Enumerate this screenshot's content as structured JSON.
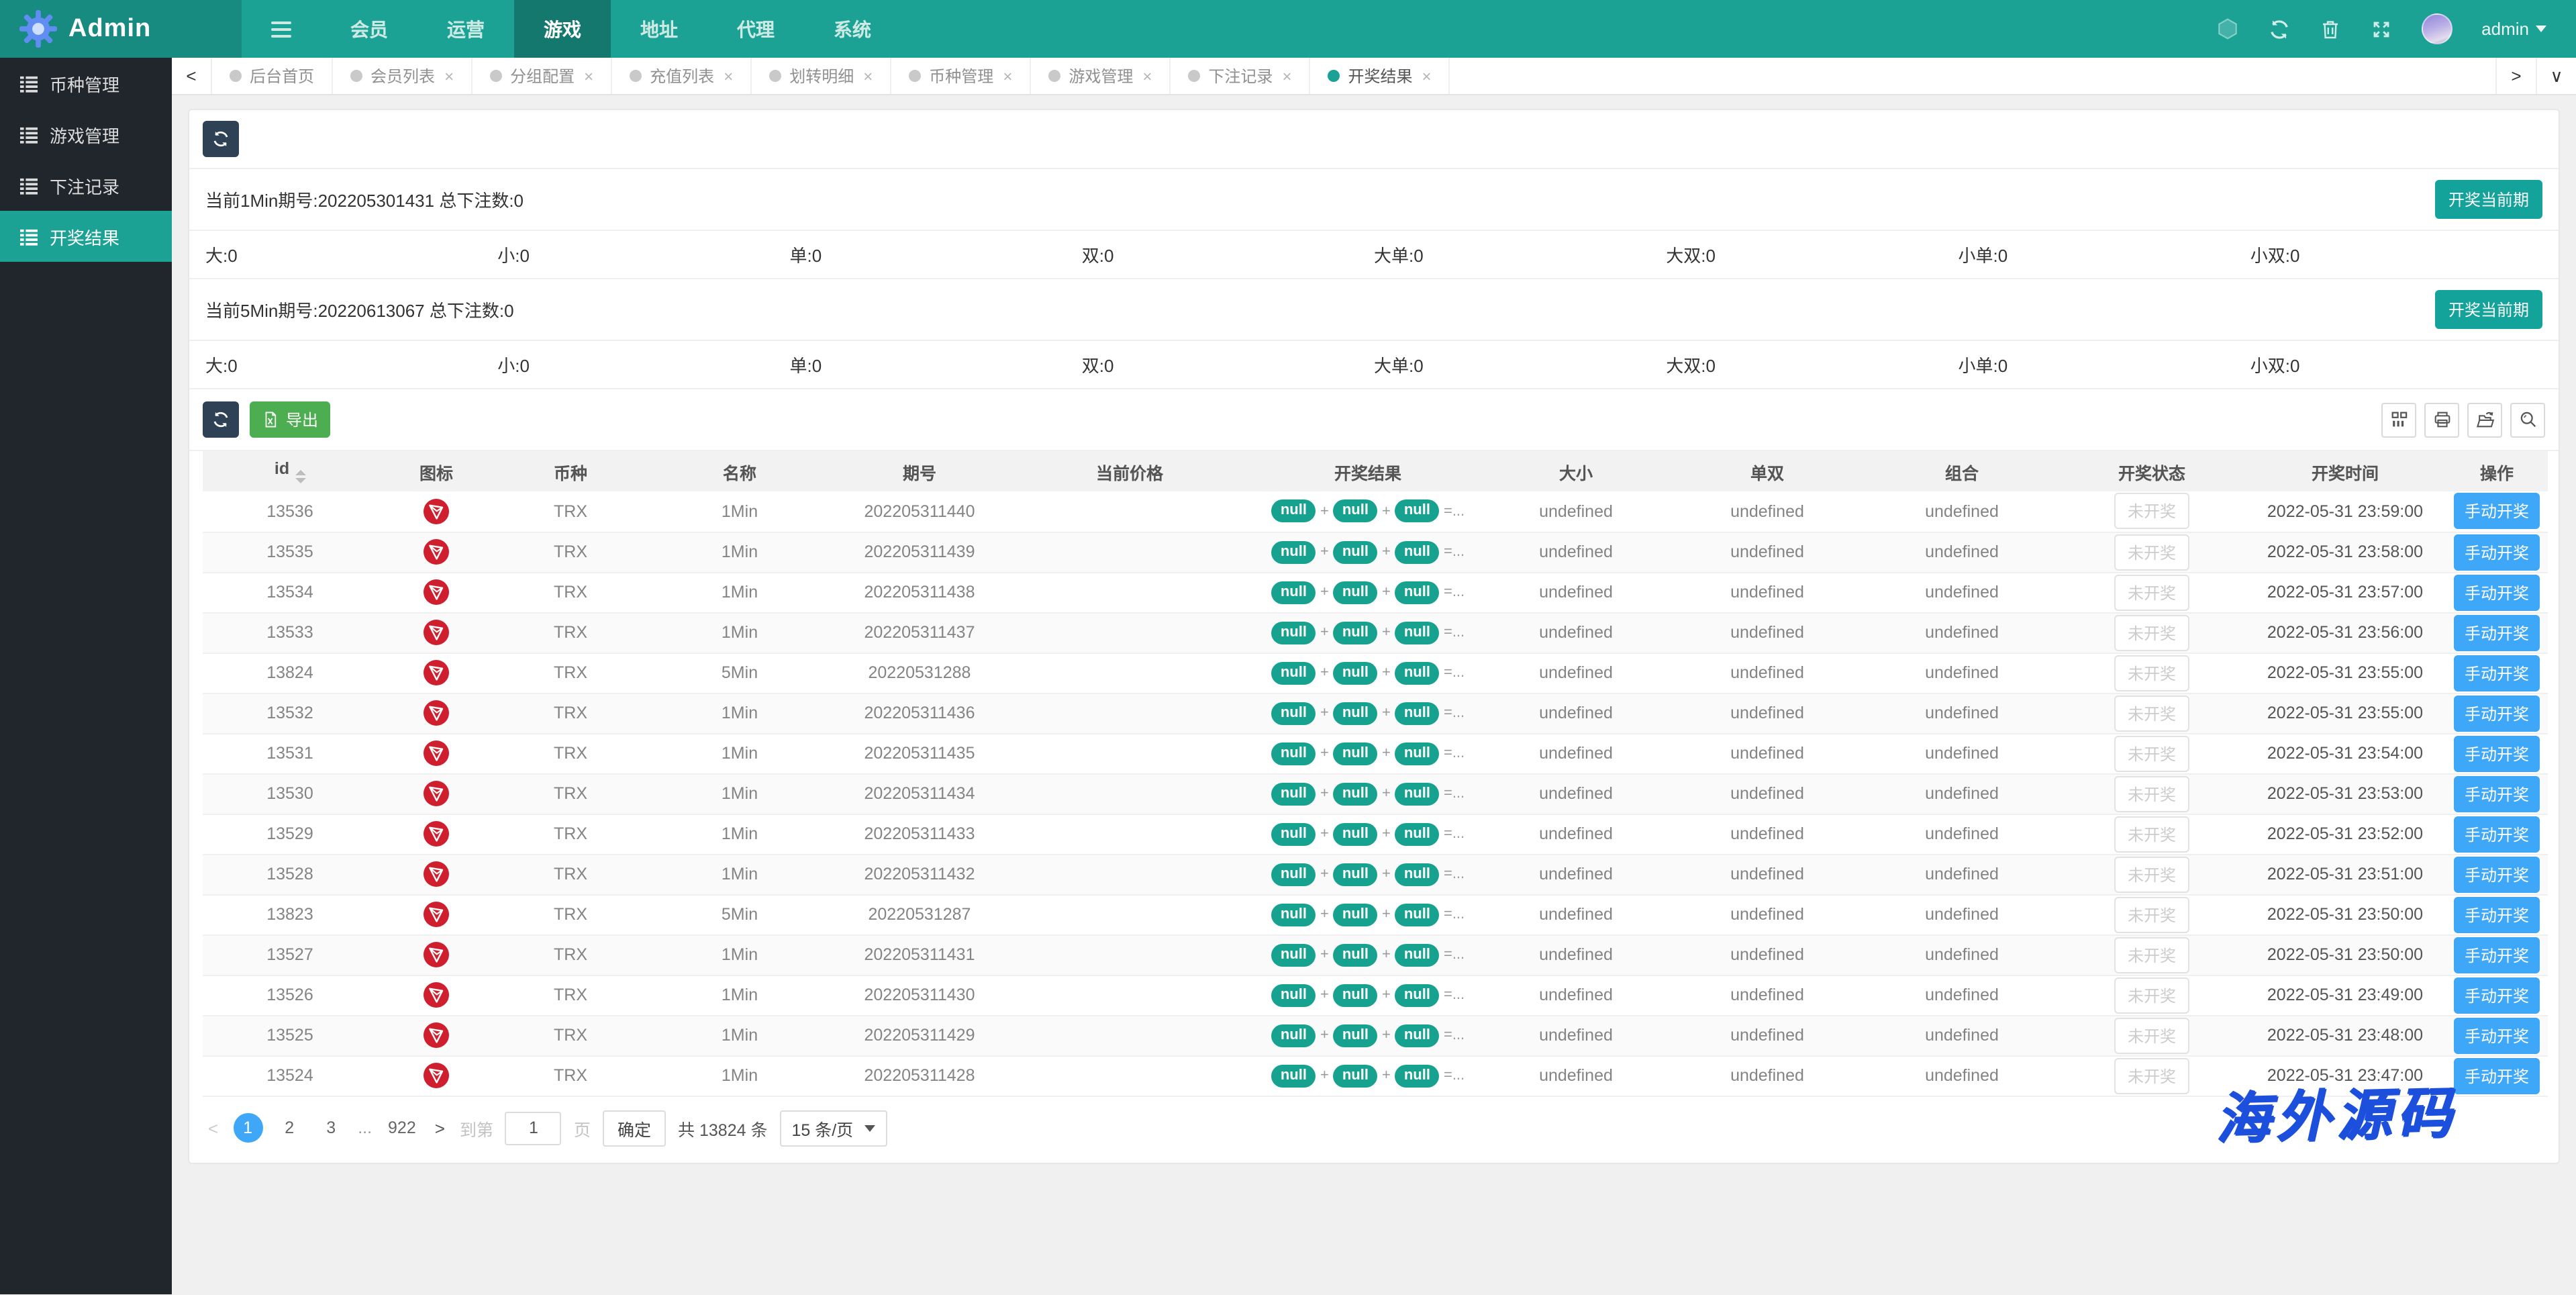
{
  "navbar": {
    "brand": "Admin",
    "menu": [
      {
        "label": "会员",
        "active": false
      },
      {
        "label": "运营",
        "active": false
      },
      {
        "label": "游戏",
        "active": true
      },
      {
        "label": "地址",
        "active": false
      },
      {
        "label": "代理",
        "active": false
      },
      {
        "label": "系统",
        "active": false
      }
    ],
    "username": "admin"
  },
  "sidebar": {
    "items": [
      {
        "label": "币种管理",
        "active": false
      },
      {
        "label": "游戏管理",
        "active": false
      },
      {
        "label": "下注记录",
        "active": false
      },
      {
        "label": "开奖结果",
        "active": true
      }
    ]
  },
  "tabs": [
    {
      "label": "后台首页",
      "closable": false,
      "active": false
    },
    {
      "label": "会员列表",
      "closable": true,
      "active": false
    },
    {
      "label": "分组配置",
      "closable": true,
      "active": false
    },
    {
      "label": "充值列表",
      "closable": true,
      "active": false
    },
    {
      "label": "划转明细",
      "closable": true,
      "active": false
    },
    {
      "label": "币种管理",
      "closable": true,
      "active": false
    },
    {
      "label": "游戏管理",
      "closable": true,
      "active": false
    },
    {
      "label": "下注记录",
      "closable": true,
      "active": false
    },
    {
      "label": "开奖结果",
      "closable": true,
      "active": true
    }
  ],
  "panels": [
    {
      "title": "当前1Min期号:202205301431 总下注数:0",
      "button": "开奖当前期",
      "stats": [
        {
          "label": "大",
          "value": "0"
        },
        {
          "label": "小",
          "value": "0"
        },
        {
          "label": "单",
          "value": "0"
        },
        {
          "label": "双",
          "value": "0"
        },
        {
          "label": "大单",
          "value": "0"
        },
        {
          "label": "大双",
          "value": "0"
        },
        {
          "label": "小单",
          "value": "0"
        },
        {
          "label": "小双",
          "value": "0"
        }
      ]
    },
    {
      "title": "当前5Min期号:20220613067 总下注数:0",
      "button": "开奖当前期",
      "stats": [
        {
          "label": "大",
          "value": "0"
        },
        {
          "label": "小",
          "value": "0"
        },
        {
          "label": "单",
          "value": "0"
        },
        {
          "label": "双",
          "value": "0"
        },
        {
          "label": "大单",
          "value": "0"
        },
        {
          "label": "大双",
          "value": "0"
        },
        {
          "label": "小单",
          "value": "0"
        },
        {
          "label": "小双",
          "value": "0"
        }
      ]
    }
  ],
  "toolbar": {
    "export_label": "导出"
  },
  "table": {
    "columns": [
      "id",
      "图标",
      "币种",
      "名称",
      "期号",
      "当前价格",
      "开奖结果",
      "大小",
      "单双",
      "组合",
      "开奖状态",
      "开奖时间",
      "操作"
    ],
    "result": {
      "pills": [
        "null",
        "null",
        "null"
      ],
      "suffix": "=..."
    },
    "status_label": "未开奖",
    "action_label": "手动开奖",
    "rows": [
      {
        "id": "13536",
        "coin": "TRX",
        "name": "1Min",
        "issue": "202205311440",
        "price": "",
        "size": "undefined",
        "parity": "undefined",
        "combo": "undefined",
        "time": "2022-05-31 23:59:00"
      },
      {
        "id": "13535",
        "coin": "TRX",
        "name": "1Min",
        "issue": "202205311439",
        "price": "",
        "size": "undefined",
        "parity": "undefined",
        "combo": "undefined",
        "time": "2022-05-31 23:58:00"
      },
      {
        "id": "13534",
        "coin": "TRX",
        "name": "1Min",
        "issue": "202205311438",
        "price": "",
        "size": "undefined",
        "parity": "undefined",
        "combo": "undefined",
        "time": "2022-05-31 23:57:00"
      },
      {
        "id": "13533",
        "coin": "TRX",
        "name": "1Min",
        "issue": "202205311437",
        "price": "",
        "size": "undefined",
        "parity": "undefined",
        "combo": "undefined",
        "time": "2022-05-31 23:56:00"
      },
      {
        "id": "13824",
        "coin": "TRX",
        "name": "5Min",
        "issue": "20220531288",
        "price": "",
        "size": "undefined",
        "parity": "undefined",
        "combo": "undefined",
        "time": "2022-05-31 23:55:00"
      },
      {
        "id": "13532",
        "coin": "TRX",
        "name": "1Min",
        "issue": "202205311436",
        "price": "",
        "size": "undefined",
        "parity": "undefined",
        "combo": "undefined",
        "time": "2022-05-31 23:55:00"
      },
      {
        "id": "13531",
        "coin": "TRX",
        "name": "1Min",
        "issue": "202205311435",
        "price": "",
        "size": "undefined",
        "parity": "undefined",
        "combo": "undefined",
        "time": "2022-05-31 23:54:00"
      },
      {
        "id": "13530",
        "coin": "TRX",
        "name": "1Min",
        "issue": "202205311434",
        "price": "",
        "size": "undefined",
        "parity": "undefined",
        "combo": "undefined",
        "time": "2022-05-31 23:53:00"
      },
      {
        "id": "13529",
        "coin": "TRX",
        "name": "1Min",
        "issue": "202205311433",
        "price": "",
        "size": "undefined",
        "parity": "undefined",
        "combo": "undefined",
        "time": "2022-05-31 23:52:00"
      },
      {
        "id": "13528",
        "coin": "TRX",
        "name": "1Min",
        "issue": "202205311432",
        "price": "",
        "size": "undefined",
        "parity": "undefined",
        "combo": "undefined",
        "time": "2022-05-31 23:51:00"
      },
      {
        "id": "13823",
        "coin": "TRX",
        "name": "5Min",
        "issue": "20220531287",
        "price": "",
        "size": "undefined",
        "parity": "undefined",
        "combo": "undefined",
        "time": "2022-05-31 23:50:00"
      },
      {
        "id": "13527",
        "coin": "TRX",
        "name": "1Min",
        "issue": "202205311431",
        "price": "",
        "size": "undefined",
        "parity": "undefined",
        "combo": "undefined",
        "time": "2022-05-31 23:50:00"
      },
      {
        "id": "13526",
        "coin": "TRX",
        "name": "1Min",
        "issue": "202205311430",
        "price": "",
        "size": "undefined",
        "parity": "undefined",
        "combo": "undefined",
        "time": "2022-05-31 23:49:00"
      },
      {
        "id": "13525",
        "coin": "TRX",
        "name": "1Min",
        "issue": "202205311429",
        "price": "",
        "size": "undefined",
        "parity": "undefined",
        "combo": "undefined",
        "time": "2022-05-31 23:48:00"
      },
      {
        "id": "13524",
        "coin": "TRX",
        "name": "1Min",
        "issue": "202205311428",
        "price": "",
        "size": "undefined",
        "parity": "undefined",
        "combo": "undefined",
        "time": "2022-05-31 23:47:00"
      }
    ]
  },
  "pagination": {
    "pages": [
      "1",
      "2",
      "3",
      "...",
      "922"
    ],
    "active_page": "1",
    "prev": "<",
    "next": ">",
    "goto_prefix": "到第",
    "goto_value": "1",
    "goto_suffix": "页",
    "confirm_label": "确定",
    "total_label": "共 13824 条",
    "page_size_label": "15 条/页"
  },
  "watermark": "海外源码",
  "colors": {
    "navbar_teal": "#1ba295",
    "navbar_active_teal": "#15786e",
    "sidebar_dark": "#21252c",
    "teal_button": "#13a39a",
    "pill_teal": "#16a28f",
    "export_green": "#4cae50",
    "action_blue": "#3fa7f7",
    "trx_red": "#cf1f2e",
    "dark_button_navy": "#2f4154",
    "watermark_blue": "#1d4fdd"
  }
}
